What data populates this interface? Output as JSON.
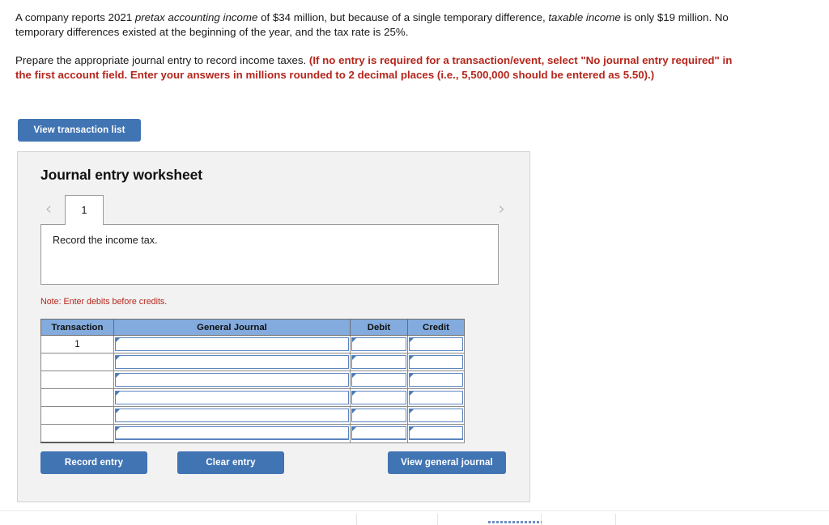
{
  "question": {
    "p1_a": "A company reports 2021 ",
    "p1_em1": "pretax accounting income",
    "p1_b": " of $34 million, but because of a single temporary difference, ",
    "p1_em2": "taxable income",
    "p1_c": " is only $19 million. No temporary differences existed at the beginning of the year, and the tax rate is 25%.",
    "p2_plain": "Prepare the appropriate journal entry to record income taxes. ",
    "p2_red": "(If no entry is required for a transaction/event, select \"No journal entry required\" in the first account field. Enter your answers in millions rounded to 2 decimal places (i.e., 5,500,000 should be entered as 5.50).)"
  },
  "toolbar": {
    "view_transaction_list_label": "View transaction list"
  },
  "worksheet": {
    "title": "Journal entry worksheet",
    "prev_chevron": "‹",
    "next_chevron": "›",
    "tabs": [
      {
        "label": "1",
        "active": true
      }
    ],
    "instruction": "Record the income tax.",
    "note": "Note: Enter debits before credits.",
    "table": {
      "headers": [
        "Transaction",
        "General Journal",
        "Debit",
        "Credit"
      ],
      "rows": [
        {
          "transaction": "1",
          "general_journal": "",
          "debit": "",
          "credit": ""
        },
        {
          "transaction": "",
          "general_journal": "",
          "debit": "",
          "credit": ""
        },
        {
          "transaction": "",
          "general_journal": "",
          "debit": "",
          "credit": ""
        },
        {
          "transaction": "",
          "general_journal": "",
          "debit": "",
          "credit": ""
        },
        {
          "transaction": "",
          "general_journal": "",
          "debit": "",
          "credit": ""
        },
        {
          "transaction": "",
          "general_journal": "",
          "debit": "",
          "credit": ""
        }
      ]
    },
    "buttons": {
      "record_entry": "Record entry",
      "clear_entry": "Clear entry",
      "view_general_journal": "View general journal"
    }
  },
  "colors": {
    "button_blue": "#4174b3",
    "table_header_blue": "#83abde",
    "note_red": "#b5261c",
    "panel_bg": "#f2f2f2",
    "cell_border_blue": "#5b85be"
  }
}
